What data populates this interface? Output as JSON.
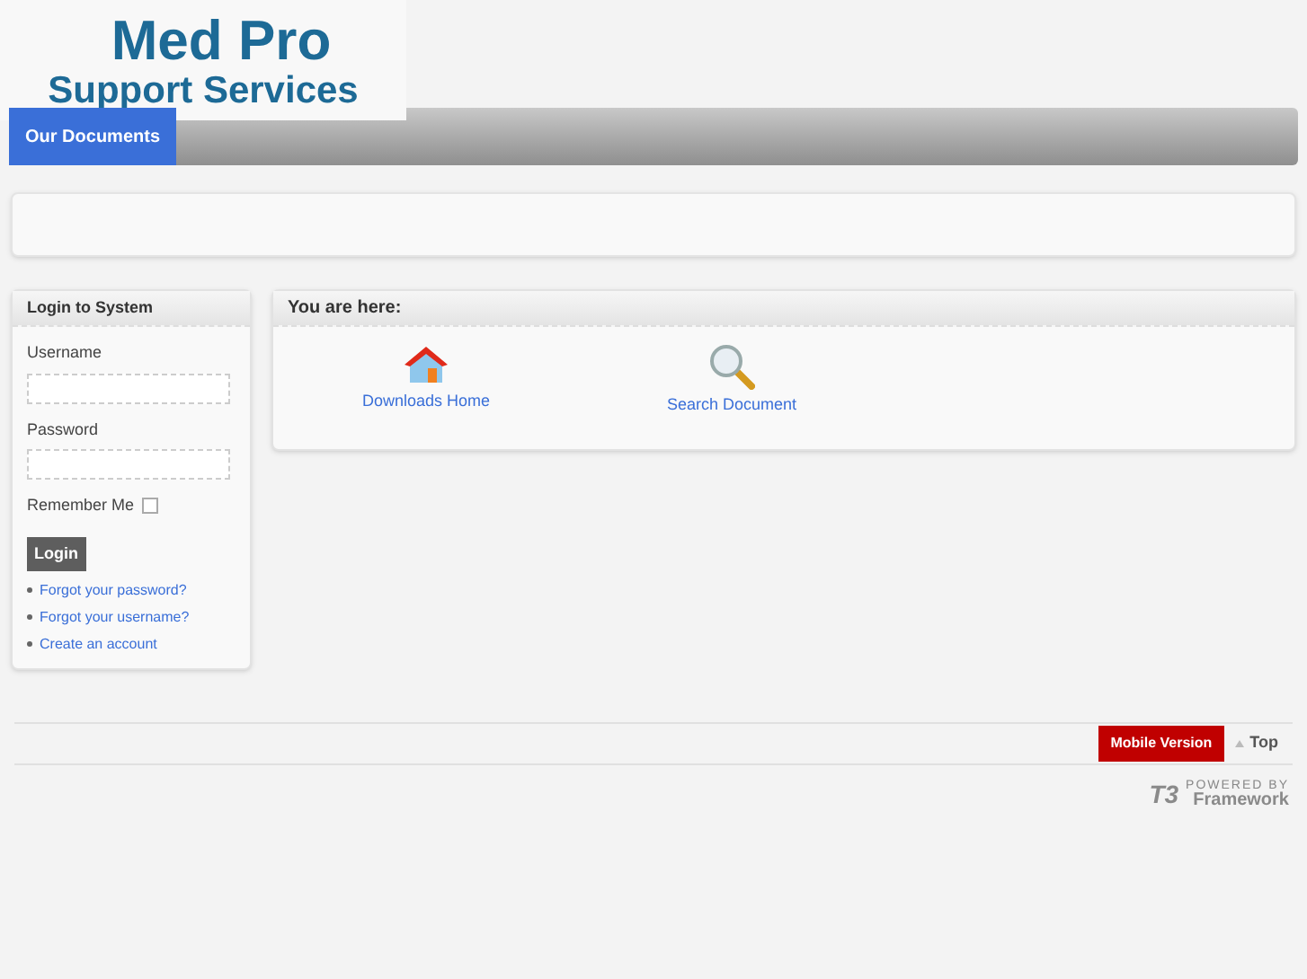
{
  "logo": {
    "line_1": "Med Pro",
    "line_2": "Support Services"
  },
  "nav": {
    "tabs": [
      {
        "label": "Our Documents",
        "selected": true
      }
    ]
  },
  "login": {
    "title": "Login to System",
    "username_label": "Username",
    "password_label": "Password",
    "remember_label": "Remember Me",
    "remember_checked": false,
    "button": "Login",
    "links": [
      "Forgot your password?",
      "Forgot your username?",
      "Create an account"
    ]
  },
  "breadcrumb": {
    "title": "You are here:",
    "items": [
      {
        "kind": "home",
        "label": "Downloads Home"
      },
      {
        "kind": "search",
        "label": "Search Document"
      }
    ]
  },
  "footer": {
    "mobile_button": "Mobile Version",
    "top_link": "Top",
    "powered_by": "POWERED BY",
    "brand_mark": "T3",
    "framework": "Framework"
  }
}
